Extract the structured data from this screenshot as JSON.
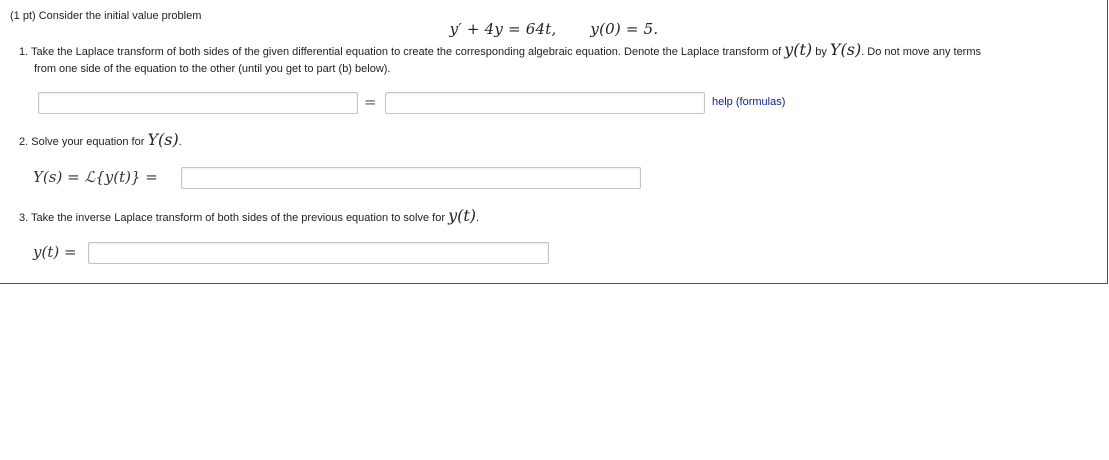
{
  "problem": {
    "header": "(1 pt) Consider the initial value problem",
    "equation": "y′ + 4y = 64t,",
    "initial_condition": "y(0) = 5."
  },
  "part1": {
    "number": "1.",
    "text_a": "Take the Laplace transform of both sides of the given differential equation to create the corresponding algebraic equation. Denote the Laplace transform of",
    "y_of_t": "y(t)",
    "by": "by",
    "Y_of_s": "Y(s)",
    "text_b": ". Do not move any terms",
    "text_c": "from one side of the equation to the other (until you get to part (b) below).",
    "lhs_value": "",
    "rhs_value": "",
    "equals": "=",
    "help_label": "help (formulas)"
  },
  "part2": {
    "number": "2.",
    "text": "Solve your equation for",
    "Y_of_s": "Y(s)",
    "period": ".",
    "prompt": "Y(s) = ℒ{y(t)} =",
    "answer_value": ""
  },
  "part3": {
    "number": "3.",
    "text": "Take the inverse Laplace transform of both sides of the previous equation to solve for",
    "y_of_t": "y(t)",
    "period": ".",
    "prompt": "y(t) =",
    "answer_value": ""
  }
}
